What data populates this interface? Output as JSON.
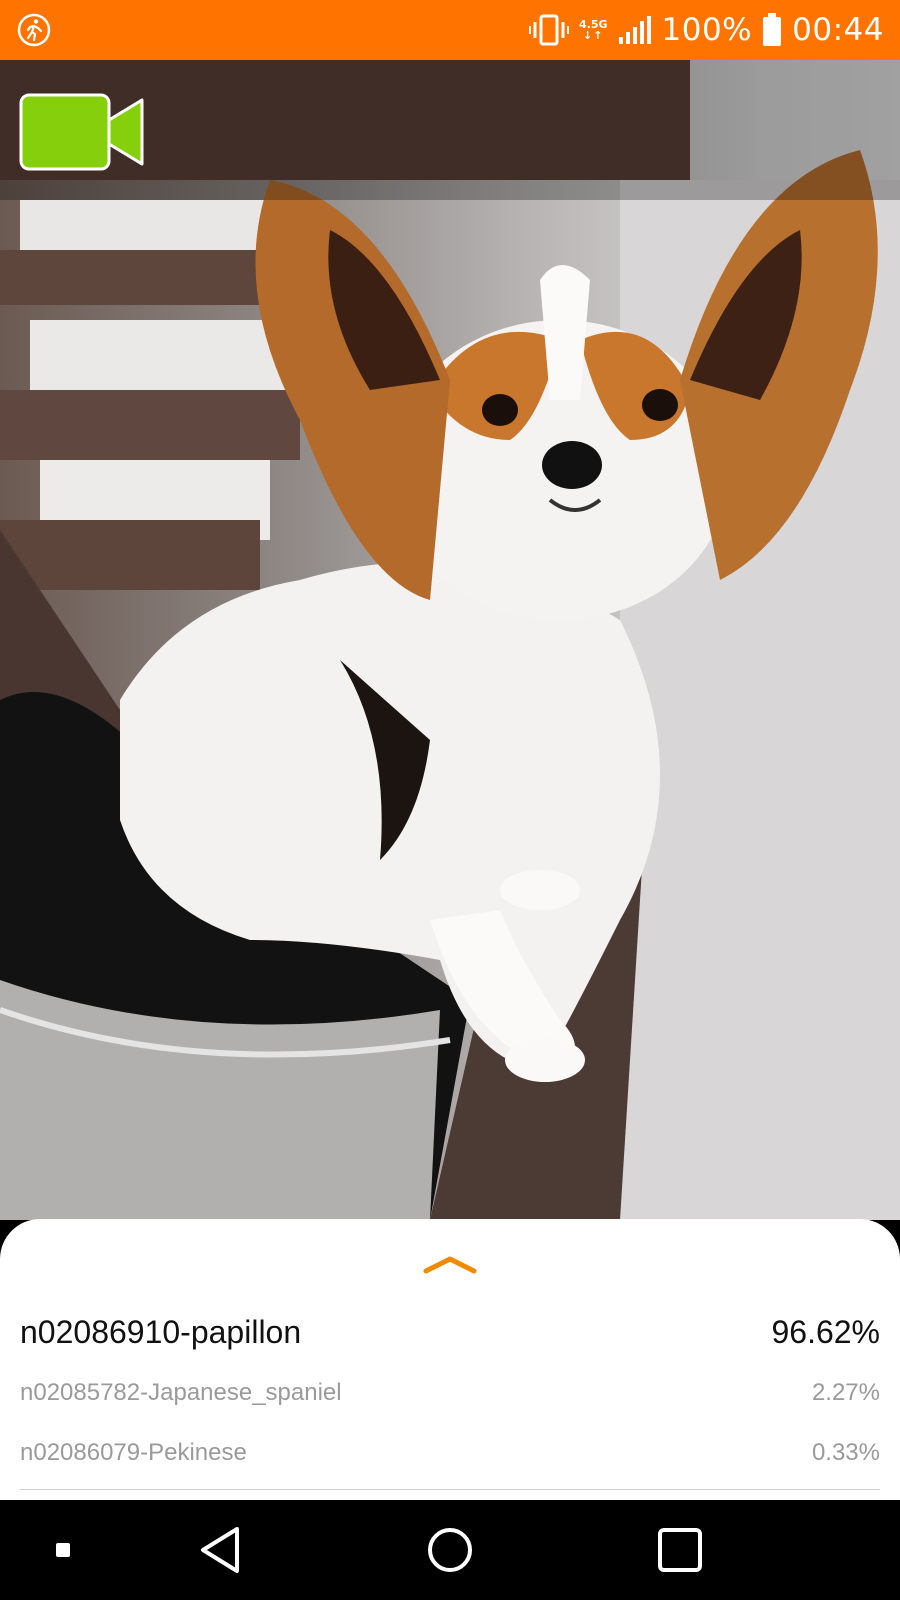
{
  "status_bar": {
    "background": "#ff7400",
    "left_icon": "activity-running-icon",
    "vibrate_icon": "vibrate-icon",
    "network_label": "4.5G",
    "signal_icon": "signal-bars-icon",
    "battery_text": "100%",
    "battery_icon": "battery-full-icon",
    "time": "00:44"
  },
  "camera": {
    "video_button_icon": "video-camera-icon",
    "video_button_color": "#86cf0c"
  },
  "results": {
    "expand_icon": "chevron-up-icon",
    "accent": "#f08a00",
    "items": [
      {
        "label": "n02086910-papillon",
        "score": "96.62%"
      },
      {
        "label": "n02085782-Japanese_spaniel",
        "score": "2.27%"
      },
      {
        "label": "n02086079-Pekinese",
        "score": "0.33%"
      }
    ]
  },
  "nav_bar": {
    "buttons": [
      "menu-square-icon",
      "back-icon",
      "home-icon",
      "recents-icon"
    ]
  }
}
